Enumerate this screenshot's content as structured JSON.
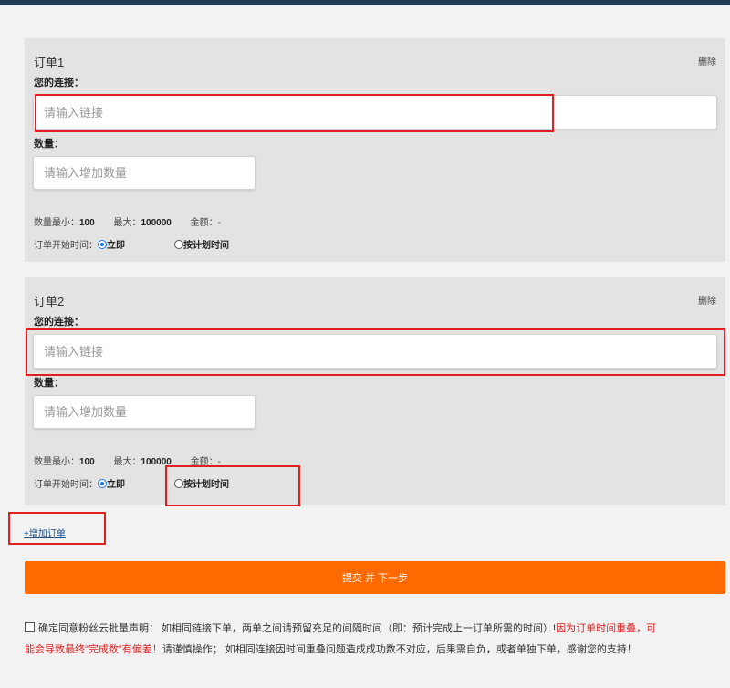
{
  "orders": [
    {
      "title": "订单1",
      "delete_label": "删除",
      "link_label": "您的连接：",
      "link_placeholder": "请输入链接",
      "qty_label": "数量：",
      "qty_placeholder": "请输入增加数量",
      "min_label": "数量最小：",
      "min_value": "100",
      "max_label": "最大：",
      "max_value": "100000",
      "amount_label": "金额：",
      "amount_value": "-",
      "start_label": "订单开始时间：",
      "opt_now": "立即",
      "opt_scheduled": "按计划时间",
      "selected": "立即"
    },
    {
      "title": "订单2",
      "delete_label": "删除",
      "link_label": "您的连接：",
      "link_placeholder": "请输入链接",
      "qty_label": "数量：",
      "qty_placeholder": "请输入增加数量",
      "min_label": "数量最小：",
      "min_value": "100",
      "max_label": "最大：",
      "max_value": "100000",
      "amount_label": "金额：",
      "amount_value": "-",
      "start_label": "订单开始时间：",
      "opt_now": "立即",
      "opt_scheduled": "按计划时间",
      "selected": "立即"
    }
  ],
  "add_order_label": "+增加订单",
  "submit_label": "提交 并 下一步",
  "agreement": {
    "text_part1": "确定同意粉丝云批量声明： 如相同链接下单，两单之间请预留充足的间隔时间（即：预计完成上一订单所需的时间）!",
    "text_warning": "因为订单时间重叠，可能会导致最终\"完成数\"有偏差！",
    "text_part2": "请谨慎操作； 如相同连接因时间重叠问题造成成功数不对应，后果需自负，或者单独下单，感谢您的支持！"
  },
  "colors": {
    "submit_bg": "#ff6a00",
    "highlight_red": "#e02020",
    "card_bg": "#e3e3e3",
    "top_bar": "#1f3a52"
  }
}
